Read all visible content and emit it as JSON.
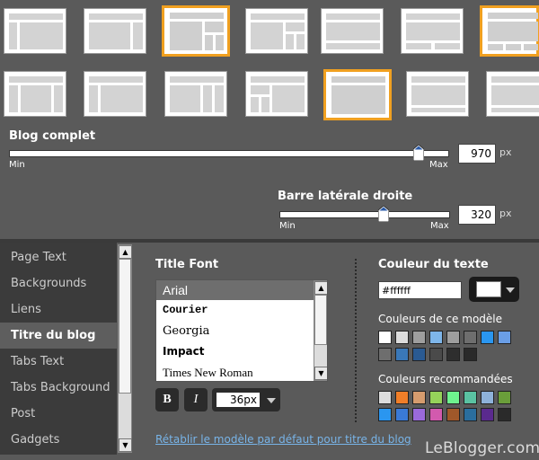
{
  "layouts": {
    "row1": [
      {
        "variant": "left-sidebar",
        "selected": false
      },
      {
        "variant": "right-sidebar",
        "selected": false
      },
      {
        "variant": "right-2col-split",
        "selected": true
      },
      {
        "variant": "right-split",
        "selected": false
      },
      {
        "variant": "single-footer",
        "selected": false
      },
      {
        "variant": "footer-2col",
        "selected": false
      },
      {
        "variant": "footer-3col",
        "selected": true
      }
    ],
    "row2": [
      {
        "variant": "both-sidebars",
        "selected": false
      },
      {
        "variant": "right-double",
        "selected": false
      },
      {
        "variant": "two-right",
        "selected": false
      },
      {
        "variant": "left-double",
        "selected": false
      },
      {
        "variant": "full-width",
        "selected": true
      },
      {
        "variant": "full-width-footer",
        "selected": false
      },
      {
        "variant": "full-width-footer2",
        "selected": false
      }
    ]
  },
  "blog_width": {
    "label": "Blog complet",
    "min_label": "Min",
    "max_label": "Max",
    "value": "970",
    "unit": "px",
    "position": 0.93
  },
  "sidebar_width": {
    "label": "Barre latérale droite",
    "min_label": "Min",
    "max_label": "Max",
    "value": "320",
    "unit": "px",
    "position": 0.61
  },
  "nav": {
    "items": [
      "Page Text",
      "Backgrounds",
      "Liens",
      "Titre du blog",
      "Tabs Text",
      "Tabs Background",
      "Post",
      "Gadgets"
    ],
    "active": "Titre du blog"
  },
  "title_font": {
    "heading": "Title Font",
    "fonts": [
      "Arial",
      "Courier",
      "Georgia",
      "Impact",
      "Times New Roman"
    ],
    "selected": "Arial",
    "bold_label": "B",
    "italic_label": "I",
    "size": "36px"
  },
  "text_color": {
    "heading": "Couleur du texte",
    "hex": "#ffffff",
    "swatch": "#ffffff",
    "template_colors_label": "Couleurs de ce modèle",
    "template_colors": [
      "#ffffff",
      "#dcdcdc",
      "#9e9e9e",
      "#7eb6ea",
      "#9e9e9e",
      "#6e6e6e",
      "#2a96f0",
      "#6a9ee6",
      "#6e6e6e",
      "#3a78b8",
      "#2a5a92",
      "#4a4a4a",
      "#2e2e2e",
      "#2a2a2a"
    ],
    "recommended_label": "Couleurs recommandées",
    "recommended_colors": [
      "#dcdcdc",
      "#f07e28",
      "#d69c6e",
      "#96d25a",
      "#6ef28e",
      "#5ac2a2",
      "#8eb2da",
      "#6a9e3a",
      "#2a96f0",
      "#3a7ad6",
      "#9a6ada",
      "#d25aae",
      "#a0582a",
      "#2a6e9e",
      "#5a2a8e",
      "#2a2a2a"
    ]
  },
  "reset_link": "Rétablir le modèle par défaut pour titre du blog",
  "watermark": "LeBlogger.com"
}
